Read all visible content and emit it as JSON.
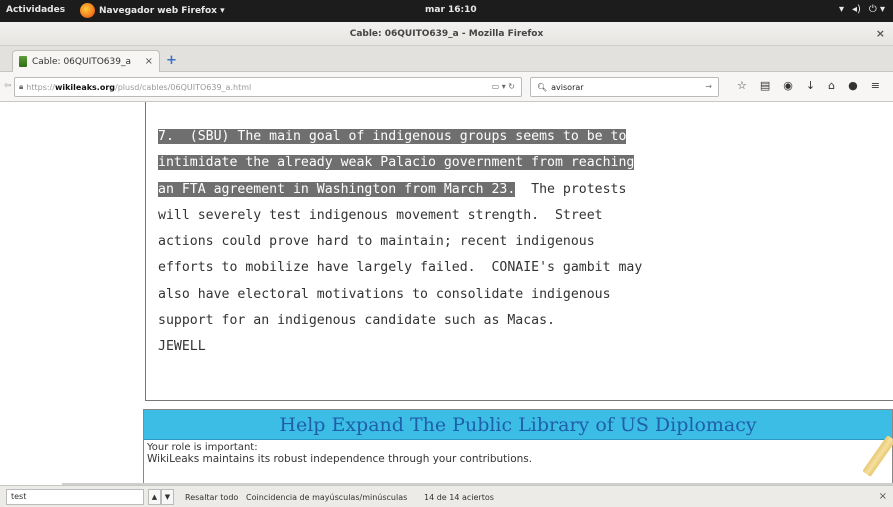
{
  "topbar": {
    "activities": "Actividades",
    "app_menu": "Navegador web Firefox ▾",
    "clock": "mar 16:10",
    "sys_icons": [
      "wifi-icon",
      "volume-icon",
      "power-icon"
    ]
  },
  "window": {
    "title": "Cable: 06QUITO639_a - Mozilla Firefox"
  },
  "tab": {
    "label": "Cable: 06QUITO639_a"
  },
  "url": {
    "scheme": "https://",
    "host": "wikileaks.org",
    "path": "/plusd/cables/06QUITO639_a.html"
  },
  "search": {
    "value": "avisorar"
  },
  "cable": {
    "highlighted_lines": [
      "7.  (SBU) The main goal of indigenous groups seems to be to",
      "intimidate the already weak Palacio government from reaching",
      "an FTA agreement in Washington from March 23."
    ],
    "line3_rest": "  The protests",
    "plain_lines": [
      "will severely test indigenous movement strength.  Street",
      "actions could prove hard to maintain; recent indigenous",
      "efforts to mobilize have largely failed.  CONAIE's gambit may",
      "also have electoral motivations to consolidate indigenous",
      "support for an indigenous candidate such as Macas.",
      "JEWELL"
    ]
  },
  "banner": {
    "title": "Help Expand The Public Library of US Diplomacy",
    "role": "Your role is important:",
    "maintains": "WikiLeaks maintains its robust independence through your contributions."
  },
  "findbar": {
    "value": "test",
    "highlight_all": "Resaltar todo",
    "match_case": "Coincidencia de mayúsculas/minúsculas",
    "count": "14 de 14 aciertos"
  },
  "colors": {
    "highlight": "#6f6f6f",
    "banner_bg": "#3cbde6",
    "banner_text": "#1f5fa8"
  }
}
